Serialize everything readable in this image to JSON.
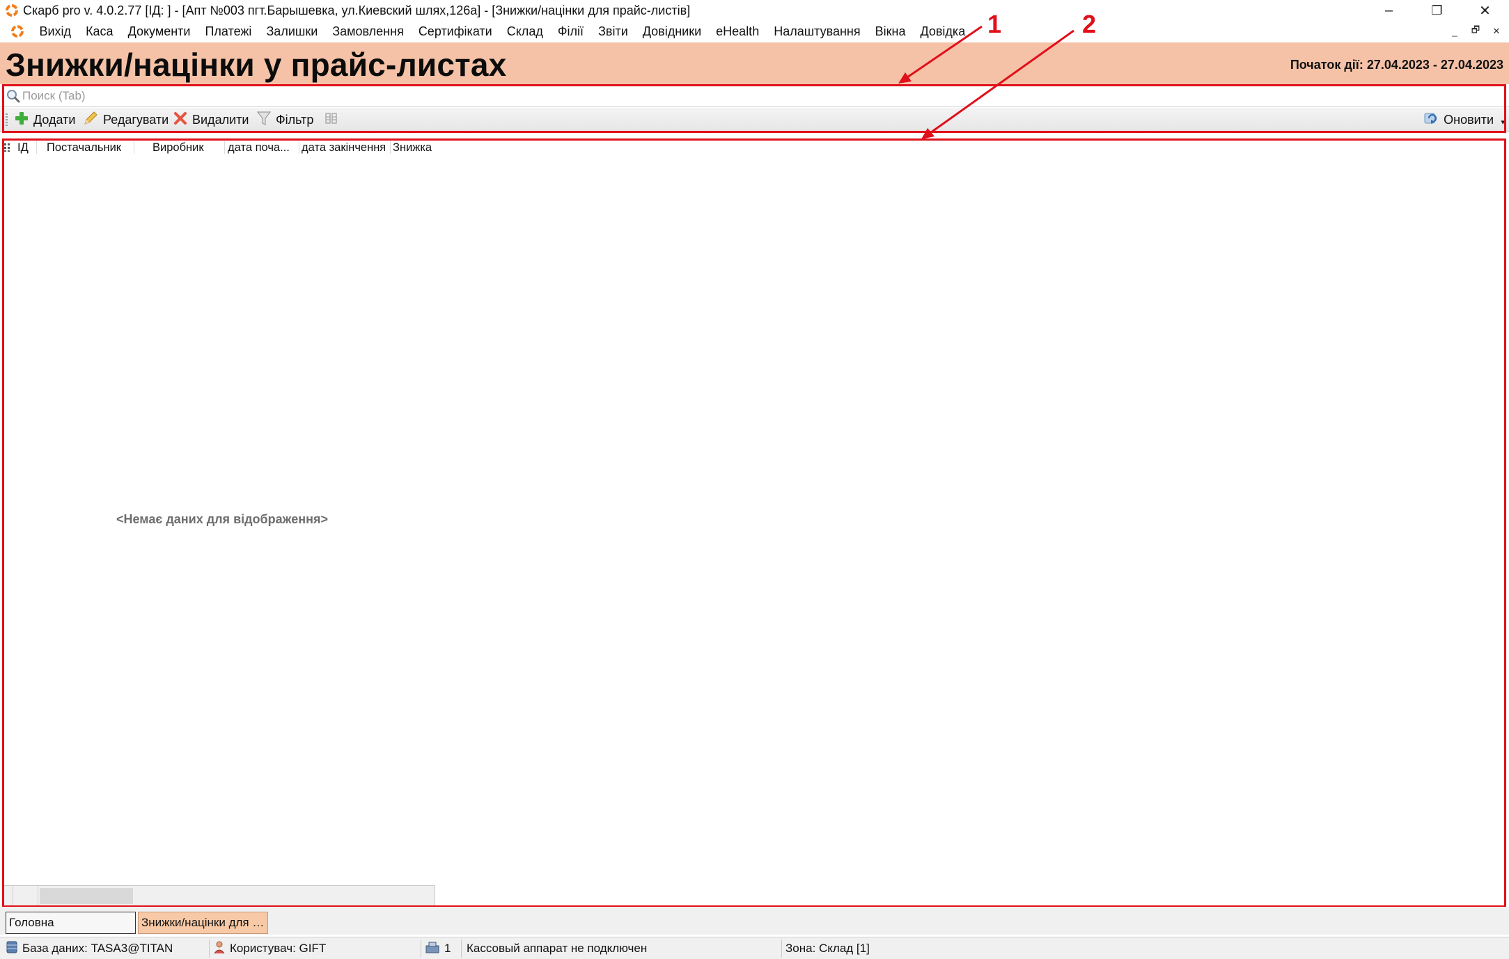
{
  "window": {
    "title": "Скарб pro v. 4.0.2.77 [ІД:        ] - [Апт №003 пгт.Барышевка, ул.Киевский шлях,126а] - [Знижки/націнки для прайс-листів]",
    "minimize_glyph": "–",
    "restore_glyph": "❐",
    "close_glyph": "✕"
  },
  "menu": {
    "items": [
      "Вихід",
      "Каса",
      "Документи",
      "Платежі",
      "Залишки",
      "Замовлення",
      "Сертифікати",
      "Склад",
      "Філії",
      "Звіти",
      "Довідники",
      "eHealth",
      "Налаштування",
      "Вікна",
      "Довідка"
    ],
    "mdi_minimize": "_",
    "mdi_restore": "🗗",
    "mdi_close": "✕"
  },
  "header": {
    "title": "Знижки/націнки у прайс-листах",
    "period": "Початок дії: 27.04.2023 - 27.04.2023"
  },
  "search": {
    "placeholder": "Поиск (Tab)",
    "value": ""
  },
  "toolbar": {
    "add_label": "Додати",
    "edit_label": "Редагувати",
    "delete_label": "Видалити",
    "filter_label": "Фільтр",
    "refresh_label": "Оновити",
    "dropdown_glyph": "▾"
  },
  "annotations": {
    "label_1": "1",
    "label_2": "2"
  },
  "grid": {
    "columns": [
      "ІД",
      "Постачальник",
      "Виробник",
      "дата поча...",
      "дата закінчення",
      "Знижка"
    ],
    "empty_message": "<Немає даних для відображення>"
  },
  "tabs": {
    "main_label": "Головна",
    "active_label": "Знижки/націнки для …"
  },
  "status": {
    "db": "База даних: TASA3@TITAN",
    "user": "Користувач: GIFT",
    "counter": "1",
    "cash_register": "Кассовый аппарат не подключен",
    "zone": "Зона: Склад [1]"
  },
  "colors": {
    "header_band": "#f5c2a7",
    "annotation_red": "#e0101a",
    "active_tab": "#f8c9a6",
    "brand_orange": "#f07d1a"
  }
}
